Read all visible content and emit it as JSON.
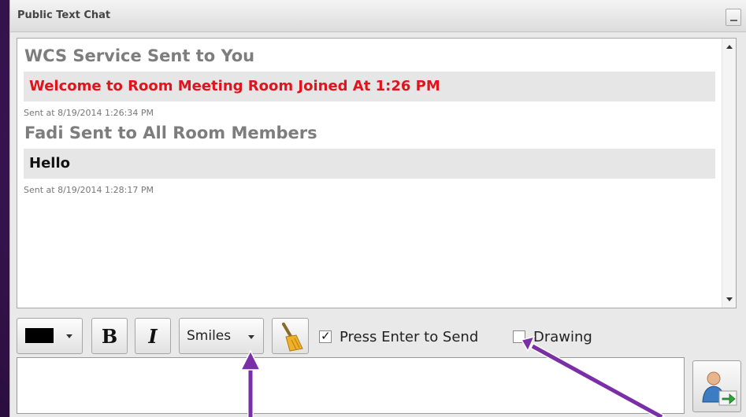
{
  "window": {
    "title": "Public Text Chat"
  },
  "messages": [
    {
      "sender": "WCS Service Sent to You",
      "text": "Welcome to Room Meeting Room Joined At 1:26 PM",
      "text_color": "#e0141c",
      "sent_at": "Sent at 8/19/2014 1:26:34 PM"
    },
    {
      "sender": "Fadi Sent to All Room Members",
      "text": "Hello",
      "text_color": "#111111",
      "sent_at": "Sent at 8/19/2014 1:28:17 PM"
    }
  ],
  "toolbar": {
    "text_color": "#000000",
    "bold_label": "B",
    "italic_label": "I",
    "smiles_label": "Smiles",
    "clear_icon": "broom-icon",
    "press_enter_label": "Press Enter to Send",
    "press_enter_checked": true,
    "drawing_label": "Drawing",
    "drawing_checked": false
  },
  "composer": {
    "value": "",
    "send_icon": "send-message-icon"
  },
  "colors": {
    "background": "#3c1656",
    "annotation_arrow": "#7a2fa6"
  }
}
